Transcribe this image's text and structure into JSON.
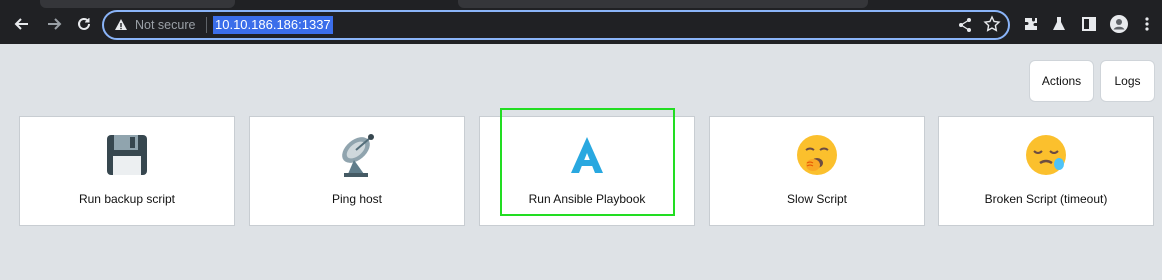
{
  "browser": {
    "security_text": "Not secure",
    "url": "10.10.186.186:1337"
  },
  "page": {
    "actions_label": "Actions",
    "logs_label": "Logs"
  },
  "cards": [
    {
      "label": "Run backup script",
      "icon": "floppy-disk-icon"
    },
    {
      "label": "Ping host",
      "icon": "satellite-antenna-icon"
    },
    {
      "label": "Run Ansible Playbook",
      "icon": "ansible-icon"
    },
    {
      "label": "Slow Script",
      "icon": "yawning-face-icon"
    },
    {
      "label": "Broken Script (timeout)",
      "icon": "sleeping-face-icon"
    }
  ],
  "colors": {
    "chrome_bg": "#202124",
    "omnibox_border": "#8ab4f8",
    "url_highlight": "#3b6eea",
    "page_bg": "#dee2e6",
    "highlight_box": "#22dd22"
  }
}
